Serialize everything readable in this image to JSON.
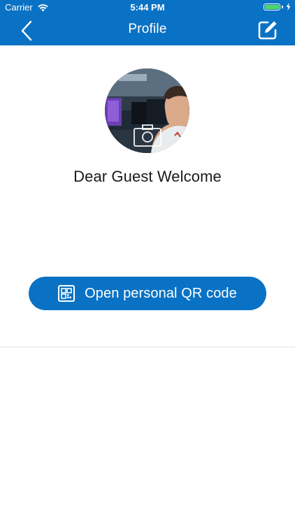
{
  "status_bar": {
    "carrier": "Carrier",
    "time": "5:44 PM",
    "battery_level": 1.0,
    "battery_color": "#4cd964",
    "icons": [
      "wifi-icon",
      "battery-icon",
      "charging-bolt-icon"
    ]
  },
  "nav": {
    "title": "Profile",
    "back_icon": "chevron-left-icon",
    "edit_icon": "edit-icon"
  },
  "profile": {
    "avatar_icon": "camera-icon",
    "welcome": "Dear Guest Welcome"
  },
  "qr_button": {
    "label": "Open personal QR code",
    "icon": "qr-code-icon"
  },
  "colors": {
    "accent": "#0a72c4",
    "background": "#ffffff",
    "divider": "#e2e2e2",
    "text": "#1a1a1a"
  }
}
